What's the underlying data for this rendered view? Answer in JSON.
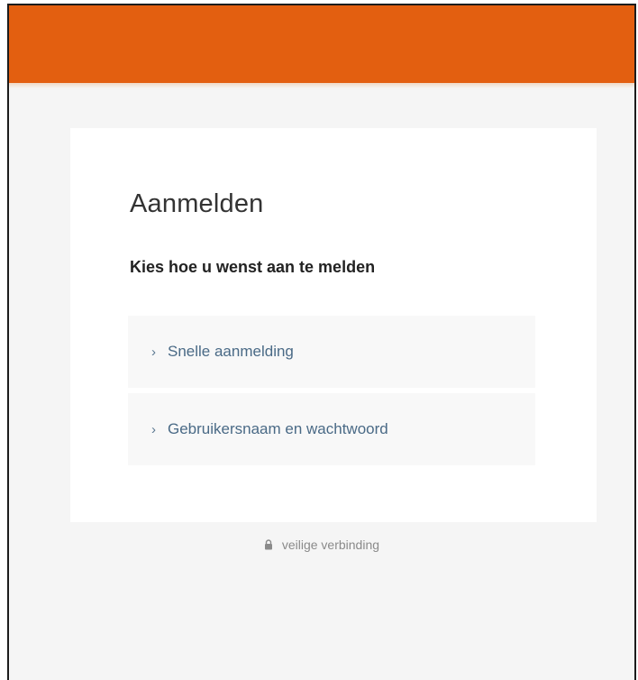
{
  "colors": {
    "header_bar": "#e35f10",
    "page_background": "#f5f5f5",
    "card_background": "#ffffff",
    "option_text": "#4a6a86"
  },
  "login": {
    "title": "Aanmelden",
    "subtitle": "Kies hoe u wenst aan te melden",
    "options": [
      {
        "label": "Snelle aanmelding",
        "icon": "chevron-right-icon"
      },
      {
        "label": "Gebruikersnaam en wachtwoord",
        "icon": "chevron-right-icon"
      }
    ]
  },
  "footer": {
    "secure_text": "veilige verbinding",
    "secure_icon": "lock-icon"
  }
}
